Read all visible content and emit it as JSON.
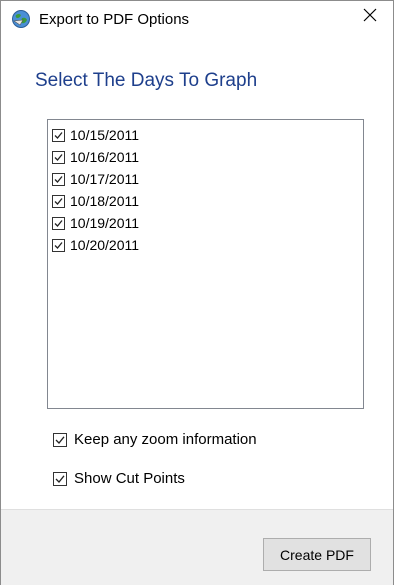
{
  "window": {
    "title": "Export to PDF Options",
    "icon": "app-globe-icon",
    "close_icon": "close-icon"
  },
  "main": {
    "heading": "Select The Days To Graph",
    "heading_color": "#1e3f8c",
    "days": [
      {
        "label": "10/15/2011",
        "checked": true
      },
      {
        "label": "10/16/2011",
        "checked": true
      },
      {
        "label": "10/17/2011",
        "checked": true
      },
      {
        "label": "10/18/2011",
        "checked": true
      },
      {
        "label": "10/19/2011",
        "checked": true
      },
      {
        "label": "10/20/2011",
        "checked": true
      }
    ]
  },
  "options": {
    "keep_zoom": {
      "label": "Keep any zoom information",
      "checked": true
    },
    "show_cut_points": {
      "label": "Show Cut Points",
      "checked": true
    }
  },
  "footer": {
    "create_pdf_label": "Create PDF"
  }
}
